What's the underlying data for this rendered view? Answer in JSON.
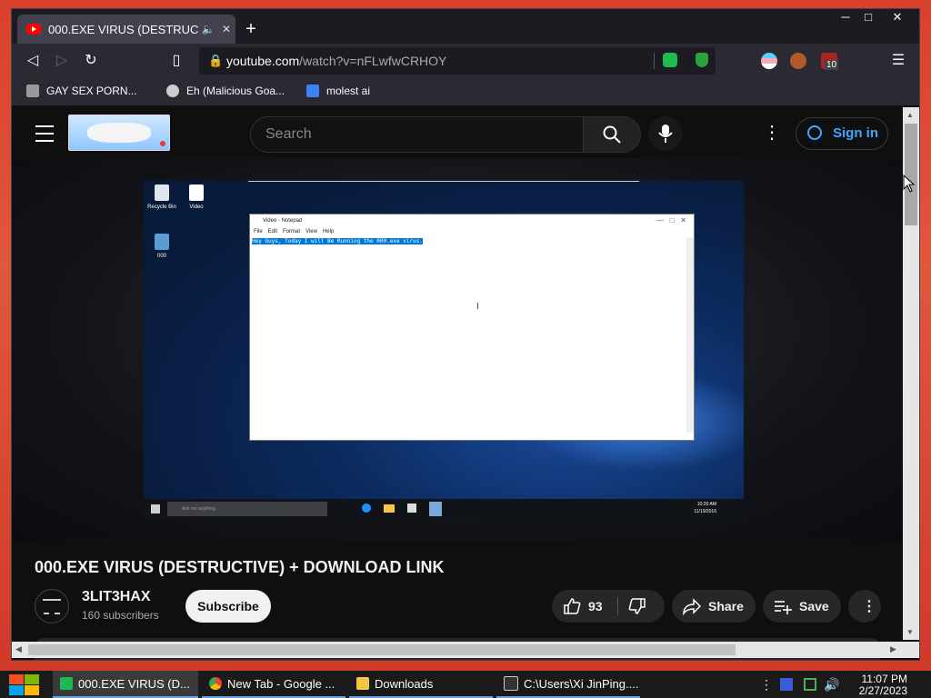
{
  "browser": {
    "tab_title": "000.EXE VIRUS (DESTRUC",
    "url_host": "youtube.com",
    "url_path": "/watch?v=nFLwfwCRHOY",
    "extension_badge": "10",
    "bookmarks": [
      "GAY SEX PORN...",
      "Eh (Malicious Goa...",
      "molest ai"
    ]
  },
  "youtube": {
    "search_placeholder": "Search",
    "sign_in": "Sign in"
  },
  "video_frame": {
    "desktop_icons": [
      "Recycle Bin",
      "Video",
      "000"
    ],
    "notepad_title": "Video - Notepad",
    "notepad_menu": [
      "File",
      "Edit",
      "Format",
      "View",
      "Help"
    ],
    "notepad_text": "Hey Guys, Today I will Be Running the 000.exe virus.",
    "taskbar_search": "Ask me anything",
    "time": "10:20 AM",
    "date": "11/19/2016"
  },
  "video": {
    "title": "000.EXE VIRUS (DESTRUCTIVE) + DOWNLOAD LINK",
    "channel": "3LIT3HAX",
    "subscribers": "160 subscribers",
    "subscribe_label": "Subscribe",
    "likes": "93",
    "share_label": "Share",
    "save_label": "Save"
  },
  "taskbar": {
    "items": [
      "000.EXE VIRUS (D...",
      "New Tab - Google ...",
      "Downloads",
      "C:\\Users\\Xi JinPing...."
    ],
    "time": "11:07 PM",
    "date": "2/27/2023"
  },
  "colors": {
    "youtube_red": "#ff0000",
    "link_blue": "#3ea6ff",
    "selection_blue": "#0078d7"
  }
}
